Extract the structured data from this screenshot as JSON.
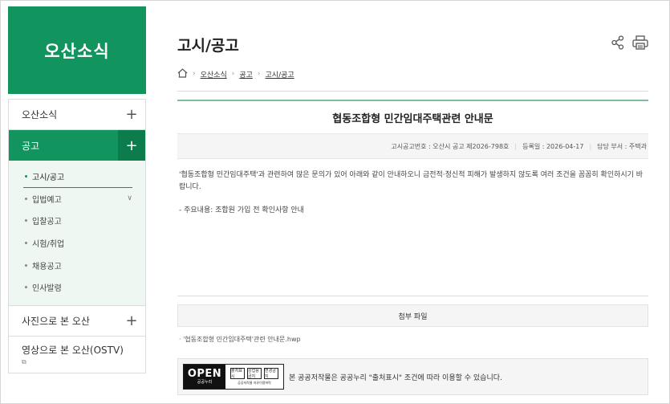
{
  "sidebar": {
    "title": "오산소식",
    "items": [
      {
        "label": "오산소식",
        "toggle": "+"
      },
      {
        "label": "공고",
        "toggle": "+"
      }
    ],
    "sub_items": [
      {
        "label": "고시/공고"
      },
      {
        "label": "입법예고",
        "chevron": "∨"
      },
      {
        "label": "입찰공고"
      },
      {
        "label": "시험/취업"
      },
      {
        "label": "채용공고"
      },
      {
        "label": "인사발령"
      }
    ],
    "items_after": [
      {
        "label": "사진으로 본 오산",
        "toggle": "+"
      },
      {
        "label": "영상으로 본 오산(OSTV)",
        "icon_glyph": "⧉"
      }
    ]
  },
  "main": {
    "page_title": "고시/공고",
    "breadcrumb": [
      "오산소식",
      "공고",
      "고시/공고"
    ],
    "article": {
      "title": "협동조합형 민간임대주택관련 안내문",
      "meta": {
        "notice_no": "고시공고번호 : 오산시 공고 제2026-798호",
        "reg_date": "등록일 : 2026-04-17",
        "dept": "담당 부서 : 주택과"
      },
      "body": [
        "'협동조합형 민간임대주택'과 관련하여 많은 문의가 있어 아래와 같이 안내하오니 금전적·정신적 피해가 발생하지 않도록 여러 조건을 꼼꼼히 확인하시기 바랍니다.",
        "- 주요내용: 조합원 가입 전 확인사항 안내"
      ]
    },
    "attachments": {
      "header": "첨부 파일",
      "files": [
        "· '협동조합형 민간임대주택'관련 안내문.hwp"
      ]
    },
    "license": {
      "logo_text": "OPEN",
      "logo_sub": "공공누리",
      "badges": [
        "출처표시",
        "상업용금지",
        "변경금지"
      ],
      "badge_caption": "공공저작물 자유이용허락",
      "text": "본 공공저작물은 공공누리 \"출처표시\" 조건에 따라 이용할 수 있습니다."
    }
  },
  "colors": {
    "brand_green": "#12945e",
    "brand_green_dark": "#0d7c4d",
    "submenu_bg": "#eef7f2",
    "article_rule": "#7fbfa0"
  },
  "icons": [
    "home-icon",
    "share-icon",
    "print-icon",
    "plus-icon",
    "chevron-down-icon",
    "external-window-icon"
  ]
}
